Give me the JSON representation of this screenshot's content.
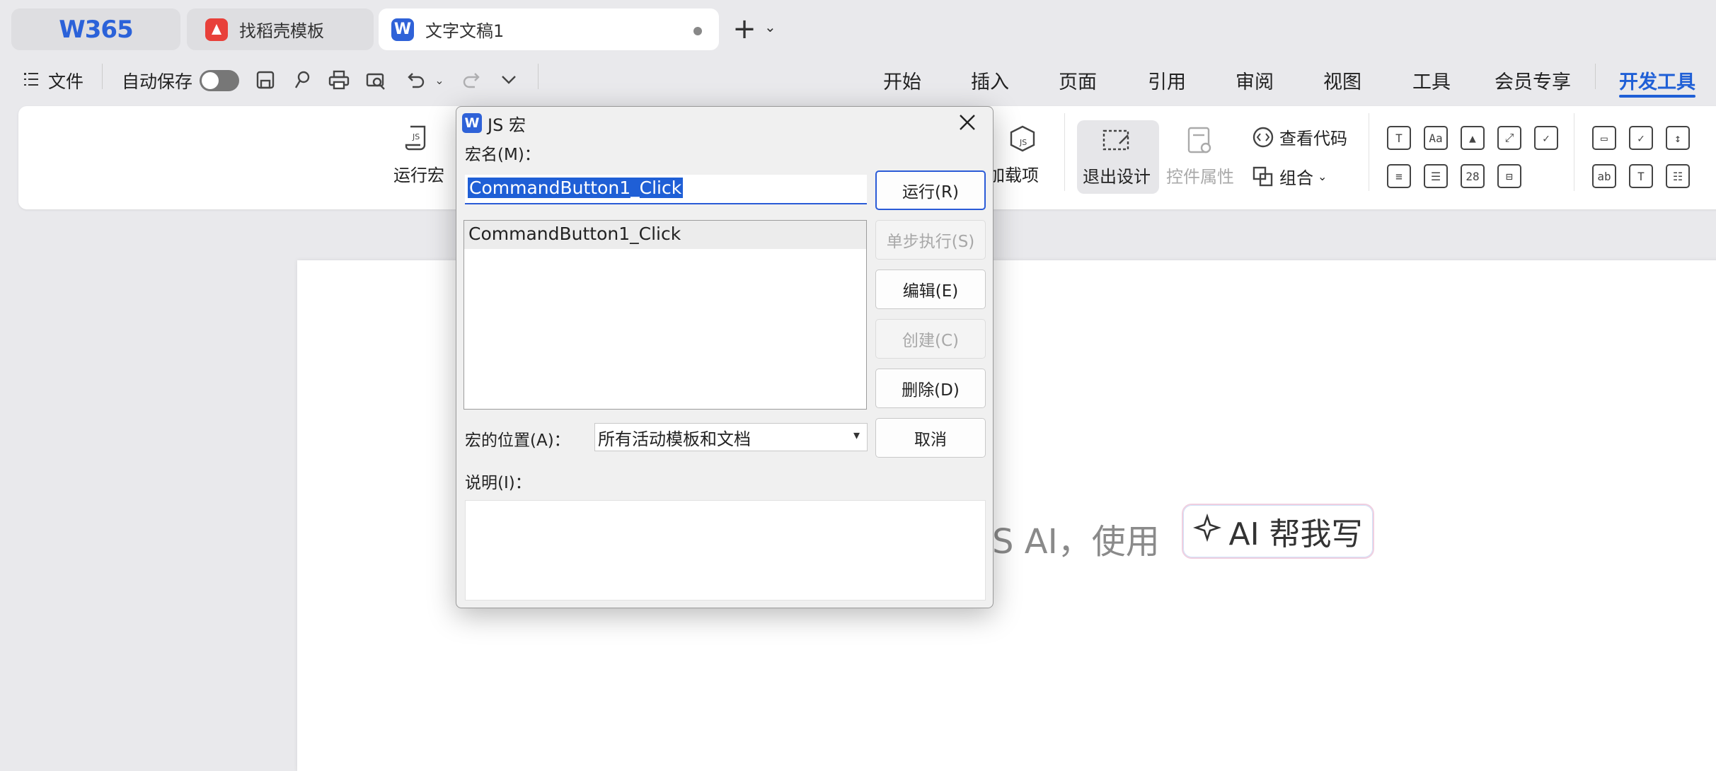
{
  "tabs": {
    "home_logo": "W365",
    "tab2_label": "找稻壳模板",
    "active_label": "文字文稿1",
    "active_icon_letter": "W",
    "new_tab": "+",
    "new_tab_dropdown": "⌄"
  },
  "quickbar": {
    "menu_label": "文件",
    "autosave_label": "自动保存"
  },
  "menu": {
    "start": "开始",
    "insert": "插入",
    "page": "页面",
    "reference": "引用",
    "review": "审阅",
    "view": "视图",
    "tools": "工具",
    "vip": "会员专享",
    "developer": "开发工具"
  },
  "ribbon": {
    "run_macro": "运行宏",
    "addins": "加载项",
    "exit_design": "退出设计",
    "control_props": "控件属性",
    "view_code": "查看代码",
    "group": "组合"
  },
  "document": {
    "hint_text": "S AI，使用",
    "ai_button": "AI 帮我写"
  },
  "dialog": {
    "title": "JS 宏",
    "macro_name_label": "宏名(M)：",
    "macro_name_value": "CommandButton1_Click",
    "macro_list": [
      "CommandButton1_Click"
    ],
    "buttons": {
      "run": "运行(R)",
      "step": "单步执行(S)",
      "edit": "编辑(E)",
      "create": "创建(C)",
      "delete": "删除(D)",
      "cancel": "取消"
    },
    "location_label": "宏的位置(A)：",
    "location_value": "所有活动模板和文档",
    "description_label": "说明(I)："
  }
}
